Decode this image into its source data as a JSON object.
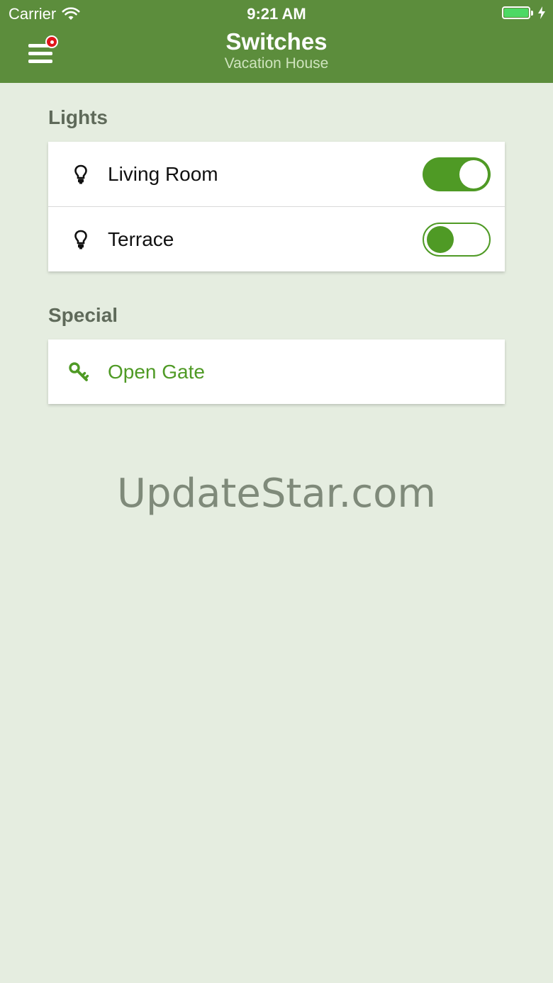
{
  "status_bar": {
    "carrier": "Carrier",
    "time": "9:21 AM",
    "battery_level": 1.0
  },
  "header": {
    "title": "Switches",
    "subtitle": "Vacation House",
    "menu_icon": "hamburger-menu-icon",
    "has_notification": true
  },
  "sections": [
    {
      "title": "Lights",
      "items": [
        {
          "label": "Living Room",
          "icon": "lightbulb-icon",
          "on": true
        },
        {
          "label": "Terrace",
          "icon": "lightbulb-icon",
          "on": false
        }
      ]
    },
    {
      "title": "Special",
      "items": [
        {
          "label": "Open Gate",
          "icon": "key-icon"
        }
      ]
    }
  ],
  "watermark": "UpdateStar.com",
  "colors": {
    "header": "#5c8d3c",
    "accent": "#4f9a25",
    "background": "#e5ede0",
    "notification": "#e0151b",
    "battery": "#4cd964"
  }
}
